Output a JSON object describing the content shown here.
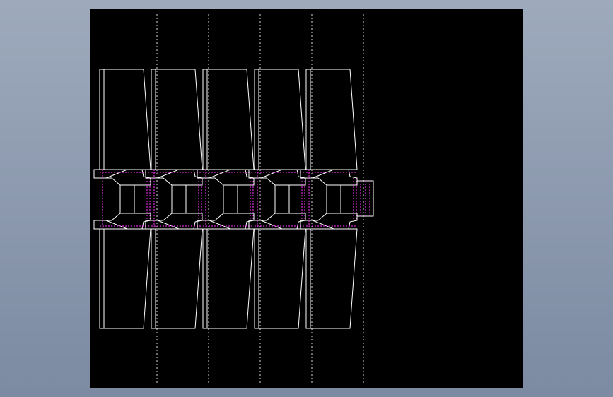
{
  "viewport": {
    "background": "#000000",
    "line_color": "#ffffff",
    "hidden_line_color": "#ff33ff",
    "centerline_color": "#ffffff"
  },
  "drawing": {
    "view": "front-section",
    "stage_count": 5,
    "stages": [
      {
        "index": 1
      },
      {
        "index": 2
      },
      {
        "index": 3
      },
      {
        "index": 4
      },
      {
        "index": 5
      }
    ]
  }
}
